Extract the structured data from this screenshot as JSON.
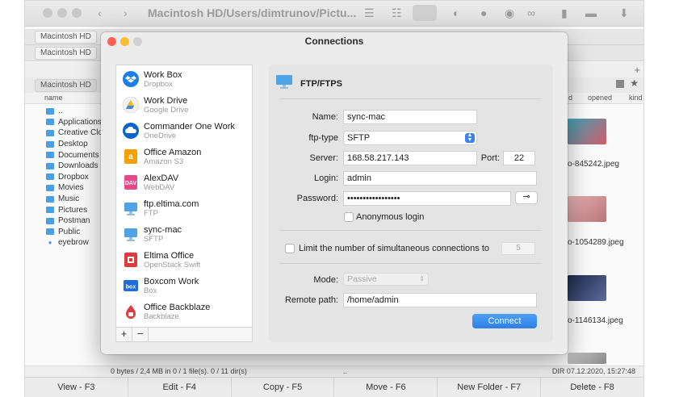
{
  "background": {
    "path_title": "Macintosh HD/Users/dimtrunov/Pictu...",
    "tabs": [
      "Macintosh HD",
      "Macintosh HD",
      "Macintosh HD"
    ],
    "left_panel": {
      "column_name": "name",
      "files": [
        {
          "name": "..",
          "type": "folder"
        },
        {
          "name": "Applications",
          "type": "folder"
        },
        {
          "name": "Creative Cloud Files",
          "type": "folder"
        },
        {
          "name": "Desktop",
          "type": "folder"
        },
        {
          "name": "Documents",
          "type": "folder"
        },
        {
          "name": "Downloads",
          "type": "folder"
        },
        {
          "name": "Dropbox",
          "type": "folder"
        },
        {
          "name": "Movies",
          "type": "folder"
        },
        {
          "name": "Music",
          "type": "folder"
        },
        {
          "name": "Pictures",
          "type": "folder"
        },
        {
          "name": "Postman",
          "type": "folder"
        },
        {
          "name": "Public",
          "type": "folder"
        },
        {
          "name": "eyebrow",
          "type": "file"
        }
      ],
      "status": "0 bytes / 2,4 MB in 0 / 1 file(s). 0 / 11 dir(s)"
    },
    "right_panel": {
      "columns": [
        "d",
        "opened",
        "kind"
      ],
      "thumbnails": [
        "o-845242.jpeg",
        "o-1054289.jpeg",
        "o-1146134.jpeg"
      ],
      "status_dots": "..",
      "status_right": "DIR  07.12.2020, 15:27:48"
    },
    "fkeys": [
      "View - F3",
      "Edit - F4",
      "Copy - F5",
      "Move - F6",
      "New Folder - F7",
      "Delete - F8"
    ]
  },
  "dialog": {
    "title": "Connections",
    "connections": [
      {
        "name": "Work Box",
        "sub": "Dropbox",
        "icon": "dropbox-icon"
      },
      {
        "name": "Work Drive",
        "sub": "Google Drive",
        "icon": "google-drive-icon"
      },
      {
        "name": "Commander One Work",
        "sub": "OneDrive",
        "icon": "onedrive-icon"
      },
      {
        "name": "Office Amazon",
        "sub": "Amazon S3",
        "icon": "amazon-icon"
      },
      {
        "name": "AlexDAV",
        "sub": "WebDAV",
        "icon": "webdav-icon"
      },
      {
        "name": "ftp.eltima.com",
        "sub": "FTP",
        "icon": "ftp-icon"
      },
      {
        "name": "sync-mac",
        "sub": "SFTP",
        "icon": "sftp-icon"
      },
      {
        "name": "Eltima Office",
        "sub": "OpenStack Swift",
        "icon": "openstack-icon"
      },
      {
        "name": "Boxcom Work",
        "sub": "Box",
        "icon": "box-icon"
      },
      {
        "name": "Office Backblaze",
        "sub": "Backblaze",
        "icon": "backblaze-icon"
      }
    ],
    "add_label": "+",
    "remove_label": "−",
    "form": {
      "header": "FTP/FTPS",
      "name_label": "Name:",
      "name_value": "sync-mac",
      "ftp_type_label": "ftp-type",
      "ftp_type_value": "SFTP",
      "server_label": "Server:",
      "server_value": "168.58.217.143",
      "port_label": "Port:",
      "port_value": "22",
      "login_label": "Login:",
      "login_value": "admin",
      "password_label": "Password:",
      "password_value": "•••••••••••••••••",
      "anonymous_label": "Anonymous login",
      "limit_label": "Limit the number of simultaneous connections to",
      "limit_value": "5",
      "mode_label": "Mode:",
      "mode_value": "Passive",
      "remote_path_label": "Remote path:",
      "remote_path_value": "/home/admin",
      "connect_label": "Connect"
    }
  }
}
